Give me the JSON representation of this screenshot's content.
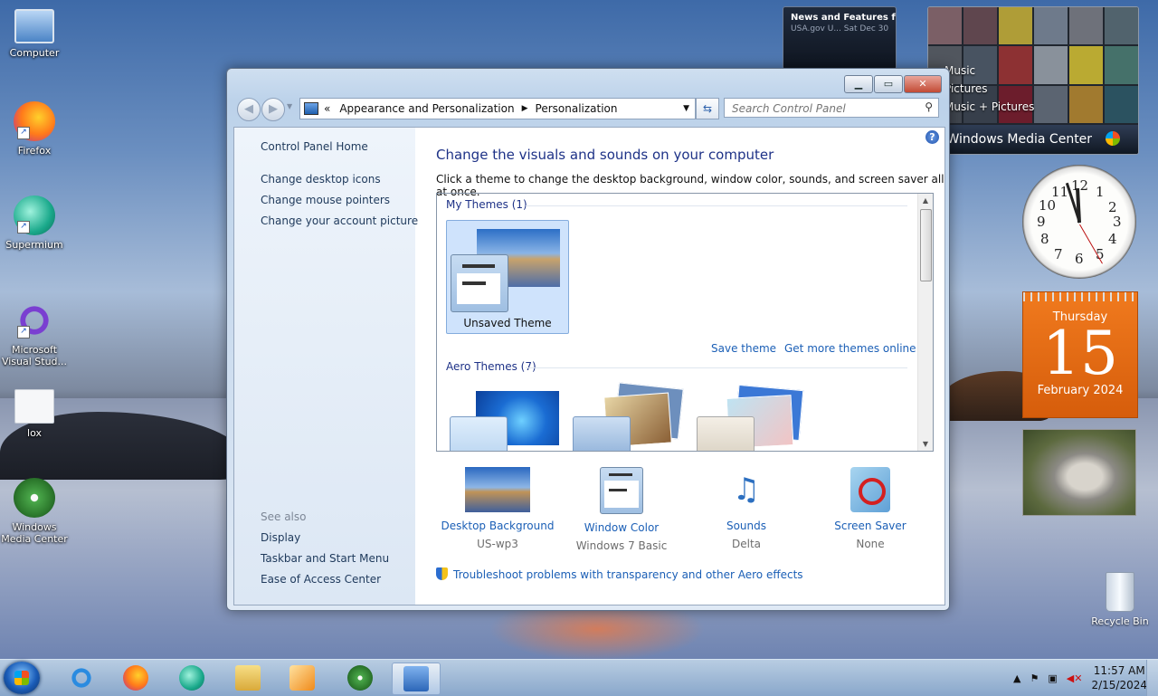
{
  "desktop": {
    "icons": [
      {
        "label": "Computer"
      },
      {
        "label": "Firefox"
      },
      {
        "label": "Supermium"
      },
      {
        "label": "Microsoft Visual Stud..."
      },
      {
        "label": "lox"
      },
      {
        "label": "Windows Media Center"
      }
    ],
    "recycle_bin": "Recycle Bin"
  },
  "gadgets": {
    "news": {
      "title": "News and Features f...",
      "source": "USA.gov U...",
      "date": "Sat Dec 30"
    },
    "media_center": {
      "menu": [
        "Music",
        "Pictures",
        "Music + Pictures"
      ],
      "brand": "Windows Media Center"
    },
    "clock": {
      "numbers": [
        "12",
        "1",
        "2",
        "3",
        "4",
        "5",
        "6",
        "7",
        "8",
        "9",
        "10",
        "11"
      ]
    },
    "calendar": {
      "weekday": "Thursday",
      "day": "15",
      "month_year": "February 2024"
    }
  },
  "window": {
    "breadcrumb": {
      "sep": "«",
      "parent": "Appearance and Personalization",
      "current": "Personalization"
    },
    "search_placeholder": "Search Control Panel",
    "left_links": [
      "Control Panel Home",
      "Change desktop icons",
      "Change mouse pointers",
      "Change your account picture"
    ],
    "see_also_label": "See also",
    "see_also": [
      "Display",
      "Taskbar and Start Menu",
      "Ease of Access Center"
    ],
    "title": "Change the visuals and sounds on your computer",
    "subtitle": "Click a theme to change the desktop background, window color, sounds, and screen saver all at once.",
    "my_themes_label": "My Themes (1)",
    "unsaved_theme": "Unsaved Theme",
    "save_theme": "Save theme",
    "get_more": "Get more themes online",
    "aero_label": "Aero Themes (7)",
    "options": [
      {
        "label": "Desktop Background",
        "value": "US-wp3"
      },
      {
        "label": "Window Color",
        "value": "Windows 7 Basic"
      },
      {
        "label": "Sounds",
        "value": "Delta"
      },
      {
        "label": "Screen Saver",
        "value": "None"
      }
    ],
    "troubleshoot": "Troubleshoot problems with transparency and other Aero effects"
  },
  "taskbar": {
    "time": "11:57 AM",
    "date": "2/15/2024"
  }
}
